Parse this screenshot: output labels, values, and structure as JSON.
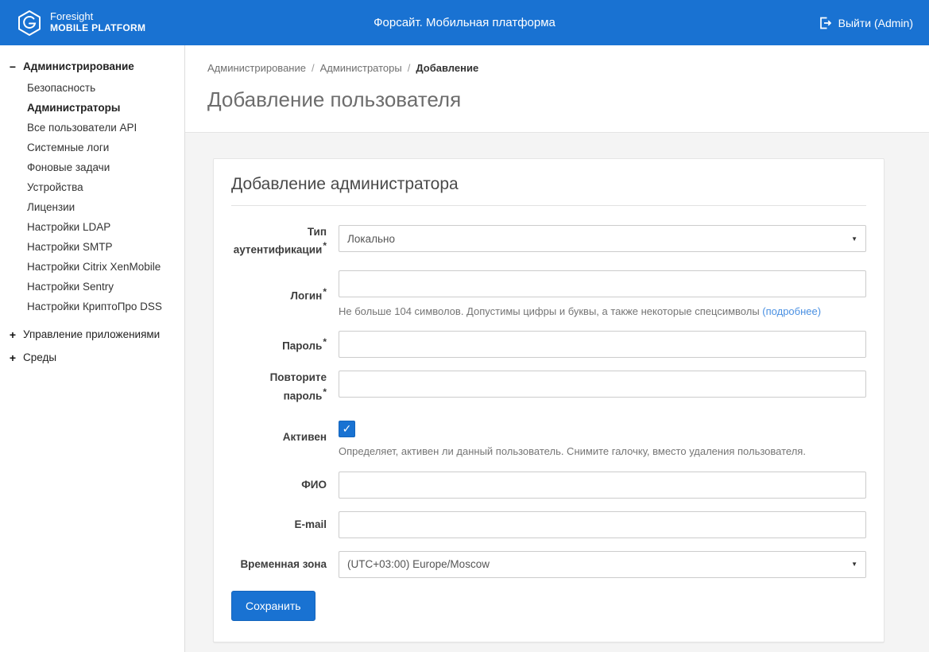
{
  "colors": {
    "header_bg": "#1972d2",
    "accent": "#1972d2",
    "link": "#4a90e2",
    "page_bg": "#f4f4f4"
  },
  "header": {
    "logo_line1": "Foresight",
    "logo_line2": "MOBILE PLATFORM",
    "app_title": "Форсайт. Мобильная платформа",
    "logout_label": "Выйти (Admin)"
  },
  "sidebar": {
    "sections": [
      {
        "label": "Администрирование",
        "toggle_icon": "−",
        "expanded": true,
        "items": [
          {
            "label": "Безопасность",
            "active": false
          },
          {
            "label": "Администраторы",
            "active": true
          },
          {
            "label": "Все пользователи API",
            "active": false
          },
          {
            "label": "Системные логи",
            "active": false
          },
          {
            "label": "Фоновые задачи",
            "active": false
          },
          {
            "label": "Устройства",
            "active": false
          },
          {
            "label": "Лицензии",
            "active": false
          },
          {
            "label": "Настройки LDAP",
            "active": false
          },
          {
            "label": "Настройки SMTP",
            "active": false
          },
          {
            "label": "Настройки Citrix XenMobile",
            "active": false
          },
          {
            "label": "Настройки Sentry",
            "active": false
          },
          {
            "label": "Настройки КриптоПро DSS",
            "active": false
          }
        ]
      },
      {
        "label": "Управление приложениями",
        "toggle_icon": "+",
        "expanded": false,
        "items": []
      },
      {
        "label": "Среды",
        "toggle_icon": "+",
        "expanded": false,
        "items": []
      }
    ]
  },
  "breadcrumb": {
    "separator": "/",
    "items": [
      {
        "label": "Администрирование",
        "current": false
      },
      {
        "label": "Администраторы",
        "current": false
      },
      {
        "label": "Добавление",
        "current": true
      }
    ]
  },
  "page": {
    "title": "Добавление пользователя"
  },
  "form": {
    "title": "Добавление администратора",
    "required_marker": "*",
    "select_caret": "▼",
    "auth_type": {
      "label": "Тип аутентификации",
      "value": "Локально"
    },
    "login": {
      "label": "Логин",
      "value": "",
      "help": "Не больше 104 символов. Допустимы цифры и буквы, а также некоторые спецсимволы",
      "help_link": "(подробнее)"
    },
    "password": {
      "label": "Пароль",
      "value": ""
    },
    "password_repeat": {
      "label": "Повторите пароль",
      "value": ""
    },
    "active": {
      "label": "Активен",
      "checked": true,
      "check_icon": "✓",
      "help": "Определяет, активен ли данный пользователь. Снимите галочку, вместо удаления пользователя."
    },
    "full_name": {
      "label": "ФИО",
      "value": ""
    },
    "email": {
      "label": "E-mail",
      "value": ""
    },
    "timezone": {
      "label": "Временная зона",
      "value": "(UTC+03:00) Europe/Moscow"
    },
    "save_label": "Сохранить"
  }
}
